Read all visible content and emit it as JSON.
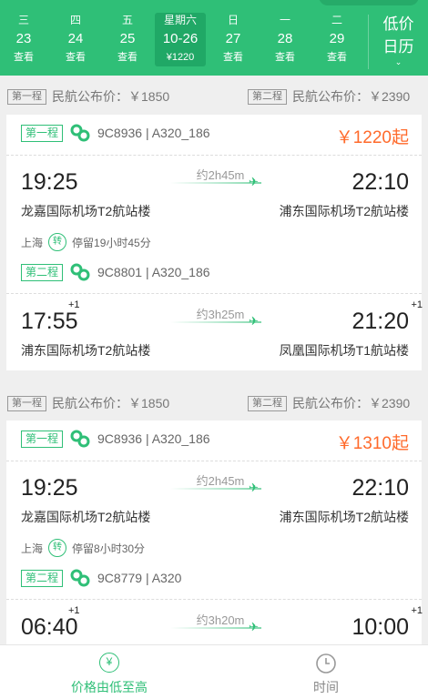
{
  "date_bar": {
    "dates": [
      {
        "weekday": "三",
        "date": "23",
        "sub": "查看"
      },
      {
        "weekday": "四",
        "date": "24",
        "sub": "查看"
      },
      {
        "weekday": "五",
        "date": "25",
        "sub": "查看"
      },
      {
        "weekday": "星期六",
        "date": "10-26",
        "sub": "¥1220"
      },
      {
        "weekday": "日",
        "date": "27",
        "sub": "查看"
      },
      {
        "weekday": "一",
        "date": "28",
        "sub": "查看"
      },
      {
        "weekday": "二",
        "date": "29",
        "sub": "查看"
      }
    ],
    "low_price": "低价",
    "calendar": "日历",
    "chevron": "⌄"
  },
  "results": [
    {
      "pub_left_tag": "第一程",
      "pub_left_text": "民航公布价：￥1850",
      "pub_right_tag": "第二程",
      "pub_right_text": "民航公布价：￥2390",
      "leg1": {
        "tag": "第一程",
        "flight": "9C8936 | A320_186",
        "price": "￥1220起",
        "dep_time": "19:25",
        "arr_time": "22:10",
        "duration": "约2h45m",
        "dep_airport": "龙嘉国际机场T2航站楼",
        "arr_airport": "浦东国际机场T2航站楼"
      },
      "transfer": {
        "city": "上海",
        "icon": "转",
        "stay": "停留19小时45分"
      },
      "leg2": {
        "tag": "第二程",
        "flight": "9C8801 | A320_186",
        "dep_time": "17:55",
        "dep_plus": "+1",
        "arr_time": "21:20",
        "arr_plus": "+1",
        "duration": "约3h25m",
        "dep_airport": "浦东国际机场T2航站楼",
        "arr_airport": "凤凰国际机场T1航站楼"
      }
    },
    {
      "pub_left_tag": "第一程",
      "pub_left_text": "民航公布价：￥1850",
      "pub_right_tag": "第二程",
      "pub_right_text": "民航公布价：￥2390",
      "leg1": {
        "tag": "第一程",
        "flight": "9C8936 | A320_186",
        "price": "￥1310起",
        "dep_time": "19:25",
        "arr_time": "22:10",
        "duration": "约2h45m",
        "dep_airport": "龙嘉国际机场T2航站楼",
        "arr_airport": "浦东国际机场T2航站楼"
      },
      "transfer": {
        "city": "上海",
        "icon": "转",
        "stay": "停留8小时30分"
      },
      "leg2": {
        "tag": "第二程",
        "flight": "9C8779 | A320",
        "dep_time": "06:40",
        "dep_plus": "+1",
        "arr_time": "10:00",
        "arr_plus": "+1",
        "duration": "约3h20m"
      }
    }
  ],
  "bottom_bar": {
    "sort_price_label": "价格由低至高",
    "sort_price_icon": "¥",
    "sort_time_label": "时间"
  },
  "colors": {
    "accent": "#2fbf77",
    "price": "#ff6a2b"
  }
}
